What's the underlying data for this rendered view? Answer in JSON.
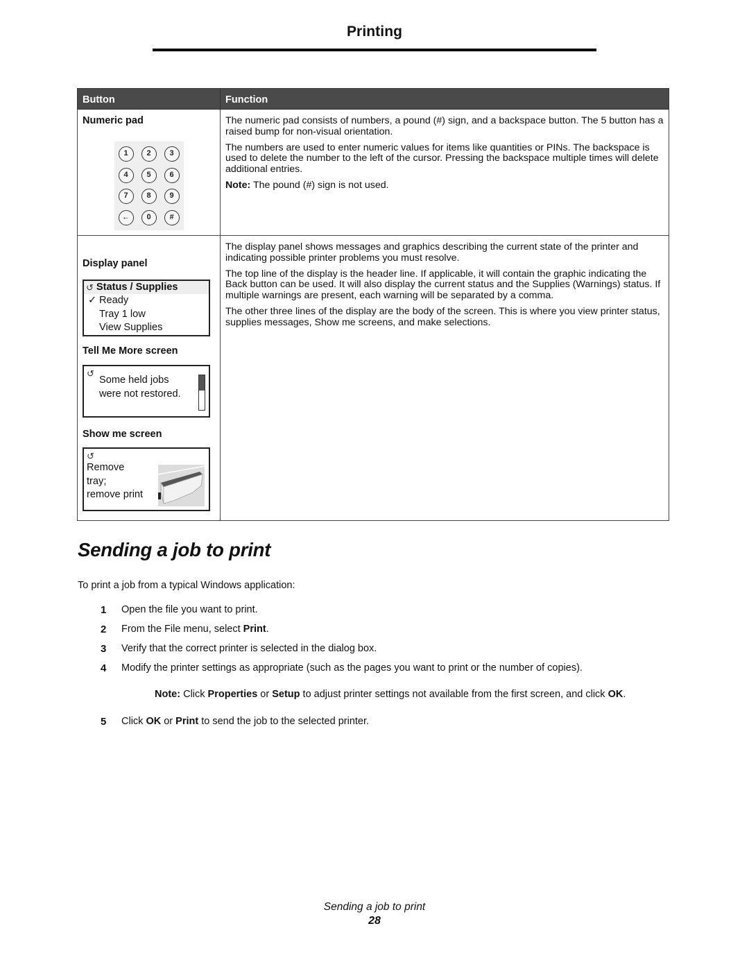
{
  "header": {
    "running_title": "Printing"
  },
  "table": {
    "columns": [
      "Button",
      "Function"
    ],
    "rows": [
      {
        "button_label": "Numeric pad",
        "keypad_keys": [
          "1",
          "2",
          "3",
          "4",
          "5",
          "6",
          "7",
          "8",
          "9",
          "←",
          "0",
          "#"
        ],
        "function_paragraphs": [
          "The numeric pad consists of numbers, a pound (#) sign, and a backspace button. The 5 button has a raised bump for non-visual orientation.",
          "The numbers are used to enter numeric values for items like quantities or PINs. The backspace is used to delete the number to the left of the cursor. Pressing the backspace multiple times will delete additional entries."
        ],
        "note_label": "Note:",
        "note_text": " The pound (#) sign is not used."
      },
      {
        "button_label": "Display panel",
        "display_panel": {
          "back_icon": "↺",
          "header": "Status / Supplies",
          "check_icon": "✓",
          "lines": [
            "Ready",
            "Tray 1 low",
            "View Supplies"
          ]
        },
        "tell_me_more_label": "Tell Me More screen",
        "tell_me_more": {
          "back_icon": "↺",
          "message_lines": [
            "Some held jobs",
            "were not restored."
          ],
          "scroll_position_fraction": 0.45
        },
        "show_me_label": "Show me screen",
        "show_me": {
          "back_icon": "↺",
          "message_lines": [
            "Remove",
            "tray;",
            "remove print"
          ],
          "image": "paper-tray-illustration"
        },
        "function_paragraphs": [
          "The display panel shows messages and graphics describing the current state of the printer and indicating possible printer problems you must resolve.",
          "The top line of the display is the header line. If applicable, it will contain the graphic indicating the Back button can be used. It will also display the current status and the Supplies (Warnings) status. If multiple warnings are present, each warning will be separated by a comma.",
          "The other three lines of the display are the body of the screen. This is where you view printer status, supplies messages, Show me screens, and make selections."
        ]
      }
    ]
  },
  "section": {
    "title": "Sending a job to print",
    "intro": "To print a job from a typical Windows application:",
    "steps": [
      {
        "num": "1",
        "parts": [
          {
            "t": "Open the file you want to print.",
            "b": false
          }
        ]
      },
      {
        "num": "2",
        "parts": [
          {
            "t": "From the File menu, select ",
            "b": false
          },
          {
            "t": "Print",
            "b": true
          },
          {
            "t": ".",
            "b": false
          }
        ]
      },
      {
        "num": "3",
        "parts": [
          {
            "t": "Verify that the correct printer is selected in the dialog box.",
            "b": false
          }
        ]
      },
      {
        "num": "4",
        "parts": [
          {
            "t": "Modify the printer settings as appropriate (such as the pages you want to print or the number of copies).",
            "b": false
          }
        ]
      }
    ],
    "note": {
      "parts": [
        {
          "t": "Note:",
          "b": true
        },
        {
          "t": " Click ",
          "b": false
        },
        {
          "t": "Properties",
          "b": true
        },
        {
          "t": " or ",
          "b": false
        },
        {
          "t": "Setup",
          "b": true
        },
        {
          "t": " to adjust printer settings not available from the first screen, and click ",
          "b": false
        },
        {
          "t": "OK",
          "b": true
        },
        {
          "t": ".",
          "b": false
        }
      ]
    },
    "step5": {
      "num": "5",
      "parts": [
        {
          "t": "Click ",
          "b": false
        },
        {
          "t": "OK",
          "b": true
        },
        {
          "t": " or ",
          "b": false
        },
        {
          "t": "Print",
          "b": true
        },
        {
          "t": " to send the job to the selected printer.",
          "b": false
        }
      ]
    }
  },
  "footer": {
    "section_title": "Sending a job to print",
    "page_number": "28"
  }
}
